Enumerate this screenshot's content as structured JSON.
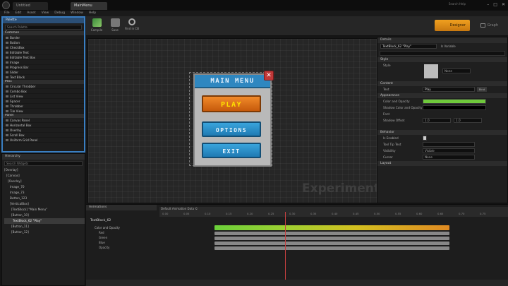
{
  "window": {
    "tab1": "Untitled",
    "tab2": "MainMenu",
    "account": "Search Help"
  },
  "menubar": [
    "File",
    "Edit",
    "Asset",
    "View",
    "Debug",
    "Window",
    "Help"
  ],
  "toolbar": {
    "compile": "Compile",
    "save": "Save",
    "find": "Find in CB",
    "designer": "Designer",
    "graph": "Graph"
  },
  "palette": {
    "title": "Palette",
    "search_placeholder": "Search Palette",
    "categories": [
      {
        "name": "Common",
        "items": [
          "Border",
          "Button",
          "CheckBox",
          "Editable Text",
          "Editable Text Box",
          "Image",
          "Progress Bar",
          "Slider",
          "Text Block"
        ]
      },
      {
        "name": "Misc",
        "items": [
          "Circular Throbber",
          "Combo Box",
          "List View",
          "Spacer",
          "Throbber",
          "Tile View"
        ]
      },
      {
        "name": "Panel",
        "items": [
          "Canvas Panel",
          "Horizontal Box",
          "Overlay",
          "Scroll Box",
          "Uniform Grid Panel"
        ]
      }
    ]
  },
  "hierarchy": {
    "title": "Hierarchy",
    "search_placeholder": "Search Widgets",
    "items": [
      "[Overlay]",
      "[Canvas]",
      "[Overlay]",
      "Image_70",
      "Image_73",
      "Button_123",
      "[VerticalBox]",
      "[TextBlock] \"Main Menu\"",
      "[Button_10]",
      "TextBlock_62 \"Play\"",
      "[Button_11]",
      "[Button_12]"
    ]
  },
  "designer": {
    "menu_title": "MAIN MENU",
    "close": "✕",
    "play": "PLAY",
    "options": "OPTIONS",
    "exit": "EXIT",
    "watermark": "Experimental"
  },
  "details": {
    "title": "Details",
    "name_value": "TextBlock_62 \"Play\"",
    "is_variable": "Is Variable",
    "sections": {
      "style": "Style",
      "style_label": "Style",
      "style_value": "None",
      "content": "Content",
      "text_label": "Text",
      "text_value": "Play",
      "bind": "Bind",
      "appearance": "Appearance",
      "color_opacity": "Color and Opacity",
      "shadow_color": "Shadow Color and Opacity",
      "font": "Font",
      "shadow_offset": "Shadow Offset",
      "shadow_x": "1.0",
      "shadow_y": "1.0",
      "behavior": "Behavior",
      "enabled": "Is Enabled",
      "tooltip": "Tool Tip Text",
      "visibility": "Visibility",
      "visibility_value": "Visible",
      "cursor": "Cursor",
      "cursor_value": "None",
      "layout": "Layout"
    },
    "colors": {
      "green": "#6fc83c",
      "shadow": "#000000"
    }
  },
  "animation": {
    "panel_title": "Animations",
    "track_name": "TextBlock_62",
    "property": "Color and Opacity",
    "channels": [
      "Red",
      "Green",
      "Blue",
      "Opacity"
    ],
    "header": "Default Animation Data ©",
    "ticks": [
      "0.00",
      "0.05",
      "0.10",
      "0.15",
      "0.20",
      "0.25",
      "0.30",
      "0.35",
      "0.40",
      "0.45",
      "0.50",
      "0.55",
      "0.60",
      "0.65",
      "0.70",
      "0.75"
    ]
  }
}
